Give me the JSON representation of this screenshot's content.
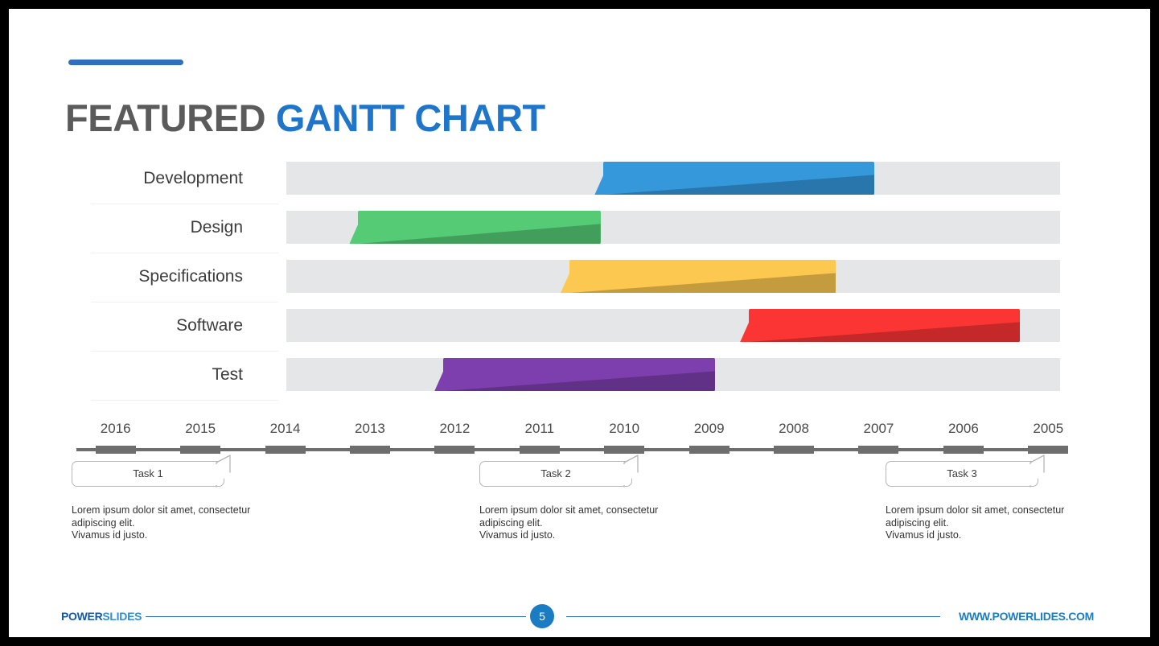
{
  "title": {
    "part1": "FEATURED ",
    "part2": "GANTT CHART",
    "color_gray": "#5b5b5b",
    "color_blue": "#1f75c9"
  },
  "chart_data": {
    "type": "bar",
    "title": "FEATURED GANTT CHART",
    "orientation": "horizontal-gantt",
    "xlabel": "",
    "ylabel": "",
    "grid": false,
    "legend": "none",
    "categories": [
      "Development",
      "Design",
      "Specifications",
      "Software",
      "Test"
    ],
    "axis_ticks": [
      "2016",
      "2015",
      "2014",
      "2013",
      "2012",
      "2011",
      "2010",
      "2009",
      "2008",
      "2007",
      "2006",
      "2005"
    ],
    "axis_direction": "descending",
    "xlim": [
      2016,
      2005
    ],
    "track_color": "#e5e6e8",
    "series": [
      {
        "name": "Development",
        "start_year": 2011.1,
        "end_year": 2006.9,
        "start_pct": 41.0,
        "end_pct": 76.0,
        "color": "#3498db"
      },
      {
        "name": "Design",
        "start_year": 2015.2,
        "end_year": 2011.5,
        "start_pct": 9.3,
        "end_pct": 40.6,
        "color": "#55cb75"
      },
      {
        "name": "Specifications",
        "start_year": 2011.6,
        "end_year": 2007.5,
        "start_pct": 36.6,
        "end_pct": 71.0,
        "color": "#fcc850"
      },
      {
        "name": "Software",
        "start_year": 2008.8,
        "end_year": 2004.6,
        "start_pct": 59.8,
        "end_pct": 94.8,
        "color": "#fb3434"
      },
      {
        "name": "Test",
        "start_year": 2012.8,
        "end_year": 2008.7,
        "start_pct": 20.3,
        "end_pct": 55.4,
        "color": "#7d3fae"
      }
    ]
  },
  "tasks": [
    {
      "label": "Task 1",
      "description": "Lorem ipsum dolor sit amet, consectetur\nadipiscing elit.\nVivamus id justo."
    },
    {
      "label": "Task 2",
      "description": "Lorem ipsum dolor sit amet, consectetur\nadipiscing elit.\nVivamus id justo."
    },
    {
      "label": "Task 3",
      "description": "Lorem ipsum dolor sit amet, consectetur\nadipiscing elit.\nVivamus id justo."
    }
  ],
  "footer": {
    "brand_part1": "POWER",
    "brand_part2": "SLIDES",
    "page_number": "5",
    "site_url": "WWW.POWERLIDES.COM",
    "accent_color": "#1a7dc4"
  }
}
